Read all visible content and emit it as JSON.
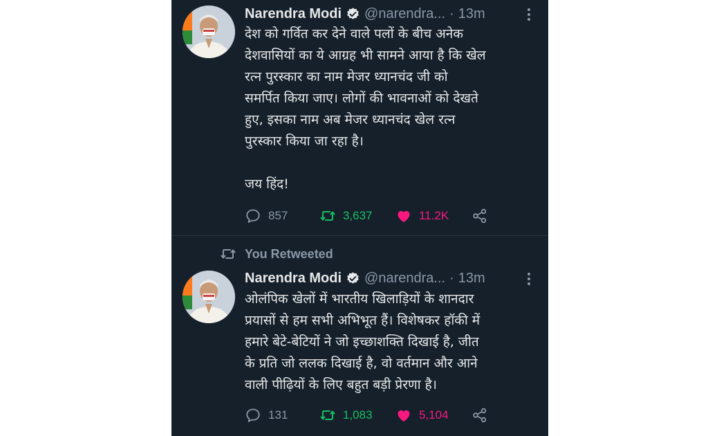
{
  "colors": {
    "background": "#15202b",
    "text": "#e7e9ea",
    "muted": "#8b98a5",
    "retweet": "#17bf63",
    "like": "#f91880",
    "verified": "#e7e9ea"
  },
  "tweets": [
    {
      "author": "Narendra Modi",
      "handle": "@narendra...",
      "separator": "·",
      "time": "13m",
      "text": "देश को गर्वित कर देने वाले पलों के बीच अनेक\nदेशवासियों का ये आग्रह भी सामने आया है कि खेल\nरत्न पुरस्कार का नाम मेजर ध्यानचंद जी को\nसमर्पित किया जाए। लोगों की भावनाओं को देखते\nहुए, इसका नाम अब मेजर ध्यानचंद खेल रत्न\nपुरस्कार किया जा रहा है।\n\nजय हिंद!",
      "replies": "857",
      "retweets": "3,637",
      "likes": "11.2K",
      "icons": {
        "reply": "reply-icon",
        "retweet": "retweet-icon",
        "like": "heart-icon",
        "share": "share-icon"
      }
    },
    {
      "retweeted_label": "You Retweeted",
      "author": "Narendra Modi",
      "handle": "@narendra...",
      "separator": "·",
      "time": "13m",
      "text": "ओलंपिक खेलों में भारतीय खिलाड़ियों के शानदार\nप्रयासों से हम सभी अभिभूत हैं। विशेषकर हॉकी में\nहमारे बेटे-बेटियों ने जो इच्छाशक्ति दिखाई है, जीत\nके प्रति जो ललक दिखाई है, वो वर्तमान और आने\nवाली पीढ़ियों के लिए बहुत बड़ी प्रेरणा है।",
      "replies": "131",
      "retweets": "1,083",
      "likes": "5,104"
    }
  ]
}
